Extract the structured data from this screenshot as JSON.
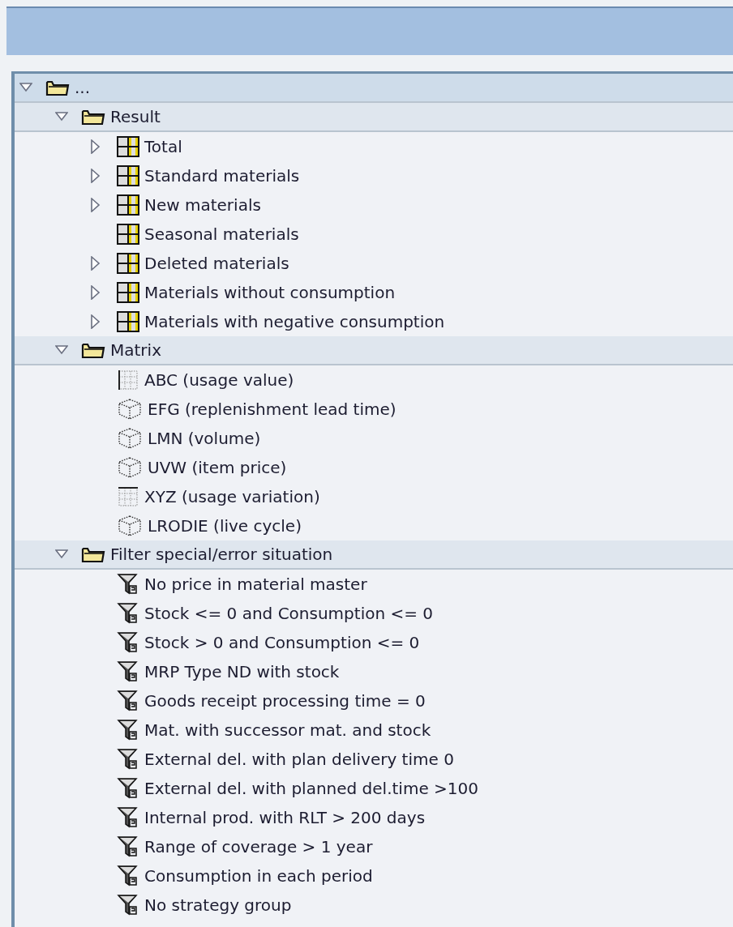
{
  "tree": {
    "label": "...",
    "kind": "folder",
    "expanded": true,
    "children": [
      {
        "label": "Result",
        "kind": "folder",
        "expanded": true,
        "children": [
          {
            "label": "Total",
            "kind": "table",
            "expanded": false
          },
          {
            "label": "Standard materials",
            "kind": "table",
            "expanded": false
          },
          {
            "label": "New materials",
            "kind": "table",
            "expanded": false
          },
          {
            "label": "Seasonal materials",
            "kind": "table"
          },
          {
            "label": "Deleted materials",
            "kind": "table",
            "expanded": false
          },
          {
            "label": "Materials without consumption",
            "kind": "table",
            "expanded": false
          },
          {
            "label": "Materials with negative consumption",
            "kind": "table",
            "expanded": false
          }
        ]
      },
      {
        "label": "Matrix",
        "kind": "folder",
        "expanded": true,
        "children": [
          {
            "label": "ABC (usage value)",
            "kind": "rowgrid"
          },
          {
            "label": "EFG (replenishment lead time)",
            "kind": "cube"
          },
          {
            "label": "LMN (volume)",
            "kind": "cube"
          },
          {
            "label": "UVW (item price)",
            "kind": "cube"
          },
          {
            "label": "XYZ (usage variation)",
            "kind": "colgrid"
          },
          {
            "label": "LRODIE (live cycle)",
            "kind": "cube"
          }
        ]
      },
      {
        "label": "Filter special/error situation",
        "kind": "folder",
        "expanded": true,
        "children": [
          {
            "label": "No price in material master",
            "kind": "filter"
          },
          {
            "label": "Stock <= 0 and Consumption <= 0",
            "kind": "filter"
          },
          {
            "label": "Stock > 0 and Consumption <= 0",
            "kind": "filter"
          },
          {
            "label": "MRP Type ND with stock",
            "kind": "filter"
          },
          {
            "label": "Goods receipt processing time = 0",
            "kind": "filter"
          },
          {
            "label": "Mat. with successor mat. and stock",
            "kind": "filter"
          },
          {
            "label": "External del. with plan delivery time 0",
            "kind": "filter"
          },
          {
            "label": "External del. with planned del.time >100",
            "kind": "filter"
          },
          {
            "label": "Internal prod. with RLT > 200 days",
            "kind": "filter"
          },
          {
            "label": "Range of coverage > 1 year",
            "kind": "filter"
          },
          {
            "label": "Consumption in each period",
            "kind": "filter"
          },
          {
            "label": "No strategy group",
            "kind": "filter"
          }
        ]
      }
    ]
  }
}
